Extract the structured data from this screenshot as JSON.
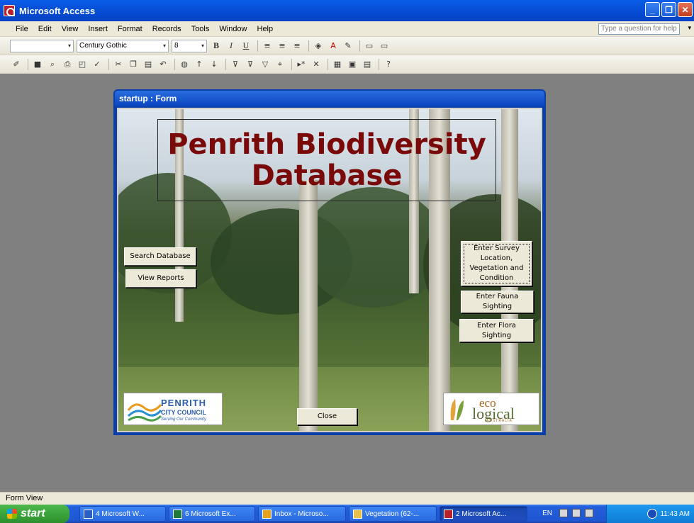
{
  "window": {
    "title": "Microsoft Access"
  },
  "menu": {
    "items": [
      "File",
      "Edit",
      "View",
      "Insert",
      "Format",
      "Records",
      "Tools",
      "Window",
      "Help"
    ],
    "help_placeholder": "Type a question for help"
  },
  "toolbar": {
    "object_combo": "",
    "font_name": "Century Gothic",
    "font_size": "8",
    "bold": "B",
    "italic": "I",
    "underline": "U"
  },
  "form": {
    "window_title": "startup : Form",
    "title_line1": "Penrith Biodiversity",
    "title_line2": "Database",
    "buttons": {
      "search": "Search Database",
      "reports": "View Reports",
      "survey": "Enter Survey Location, Vegetation and Condition",
      "fauna": "Enter Fauna Sighting",
      "flora": "Enter Flora Sighting",
      "close": "Close"
    },
    "logo_penrith": {
      "name": "PENRITH",
      "council": "CITY COUNCIL",
      "tagline": "Serving Our Community"
    },
    "logo_eco": {
      "top": "eco",
      "bottom": "logical",
      "sub": "AUSTRALIA"
    }
  },
  "statusbar": {
    "text": "Form View"
  },
  "taskbar": {
    "start": "start",
    "tasks": [
      {
        "label": "4 Microsoft W...",
        "color": "#2b5fc4"
      },
      {
        "label": "6 Microsoft Ex...",
        "color": "#1d7a3c"
      },
      {
        "label": "Inbox - Microso...",
        "color": "#e6a21c"
      },
      {
        "label": "Vegetation (62-...",
        "color": "#e8c14a"
      },
      {
        "label": "2 Microsoft Ac...",
        "color": "#b8202a"
      }
    ],
    "lang": "EN",
    "clock": "11:43 AM"
  }
}
